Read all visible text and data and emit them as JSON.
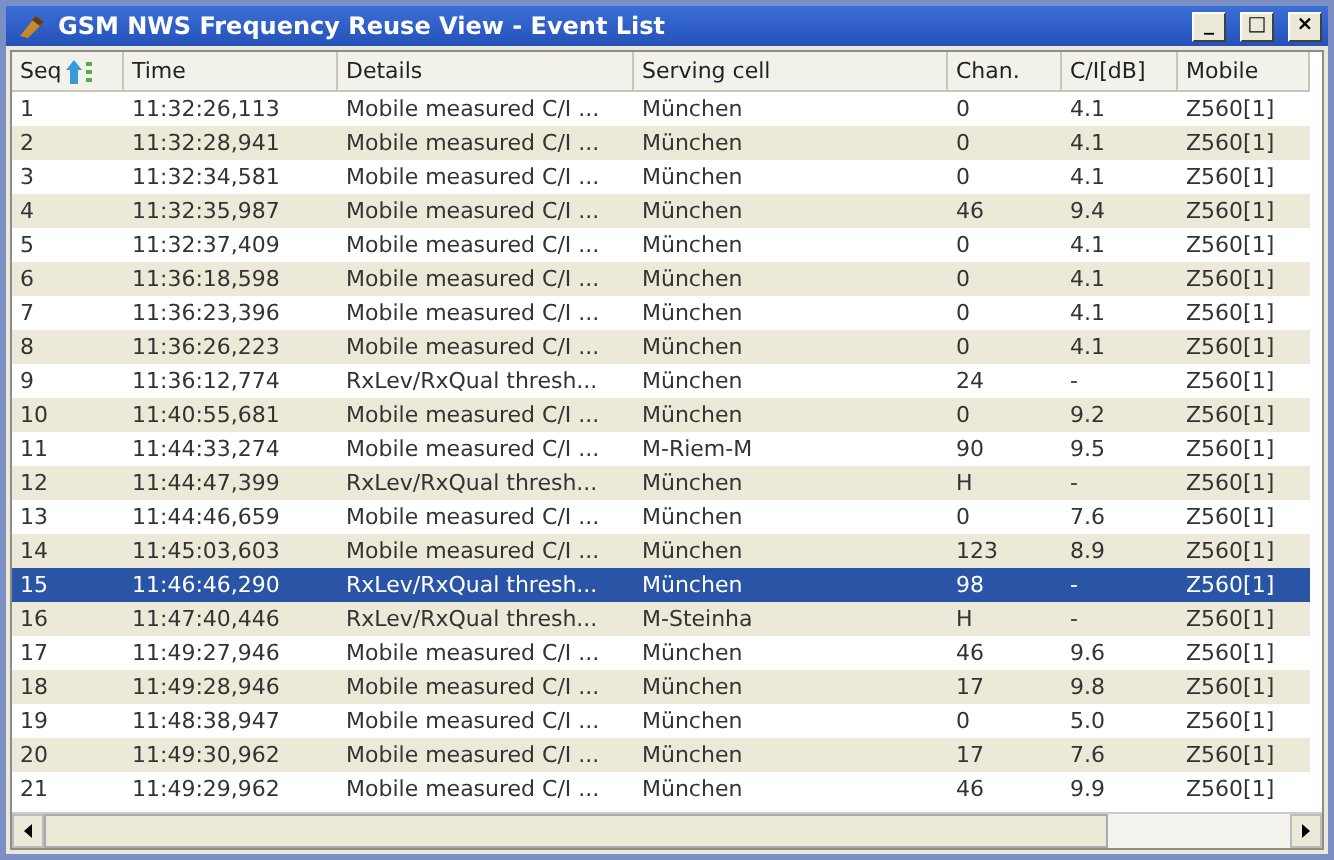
{
  "window": {
    "title": "GSM NWS Frequency Reuse View - Event List",
    "controls": [
      "_",
      "□",
      "×"
    ]
  },
  "table": {
    "columns": [
      {
        "label": "Seq",
        "sorted": true
      },
      {
        "label": "Time",
        "sorted": false
      },
      {
        "label": "Details",
        "sorted": false
      },
      {
        "label": "Serving cell",
        "sorted": false
      },
      {
        "label": "Chan.",
        "sorted": false
      },
      {
        "label": "C/I[dB]",
        "sorted": false
      },
      {
        "label": "Mobile",
        "sorted": false
      }
    ],
    "rows": [
      {
        "cells": [
          "1",
          "11:32:26,113",
          "Mobile measured C/I ...",
          "München",
          "0",
          "4.1",
          "Z560[1]"
        ],
        "selected": false
      },
      {
        "cells": [
          "2",
          "11:32:28,941",
          "Mobile measured C/I ...",
          "München",
          "0",
          "4.1",
          "Z560[1]"
        ],
        "selected": false
      },
      {
        "cells": [
          "3",
          "11:32:34,581",
          "Mobile measured C/I ...",
          "München",
          "0",
          "4.1",
          "Z560[1]"
        ],
        "selected": false
      },
      {
        "cells": [
          "4",
          "11:32:35,987",
          "Mobile measured C/I ...",
          "München",
          "46",
          "9.4",
          "Z560[1]"
        ],
        "selected": false
      },
      {
        "cells": [
          "5",
          "11:32:37,409",
          "Mobile measured C/I ...",
          "München",
          "0",
          "4.1",
          "Z560[1]"
        ],
        "selected": false
      },
      {
        "cells": [
          "6",
          "11:36:18,598",
          "Mobile measured C/I ...",
          "München",
          "0",
          "4.1",
          "Z560[1]"
        ],
        "selected": false
      },
      {
        "cells": [
          "7",
          "11:36:23,396",
          "Mobile measured C/I ...",
          "München",
          "0",
          "4.1",
          "Z560[1]"
        ],
        "selected": false
      },
      {
        "cells": [
          "8",
          "11:36:26,223",
          "Mobile measured C/I ...",
          "München",
          "0",
          "4.1",
          "Z560[1]"
        ],
        "selected": false
      },
      {
        "cells": [
          "9",
          "11:36:12,774",
          "RxLev/RxQual thresh...",
          "München",
          "24",
          "-",
          "Z560[1]"
        ],
        "selected": false
      },
      {
        "cells": [
          "10",
          "11:40:55,681",
          "Mobile measured C/I ...",
          "München",
          "0",
          "9.2",
          "Z560[1]"
        ],
        "selected": false
      },
      {
        "cells": [
          "11",
          "11:44:33,274",
          "Mobile measured C/I ...",
          "M-Riem-M",
          "90",
          "9.5",
          "Z560[1]"
        ],
        "selected": false
      },
      {
        "cells": [
          "12",
          "11:44:47,399",
          "RxLev/RxQual thresh...",
          "München",
          "H",
          "-",
          "Z560[1]"
        ],
        "selected": false
      },
      {
        "cells": [
          "13",
          "11:44:46,659",
          "Mobile measured C/I ...",
          "München",
          "0",
          "7.6",
          "Z560[1]"
        ],
        "selected": false
      },
      {
        "cells": [
          "14",
          "11:45:03,603",
          "Mobile measured C/I ...",
          "München",
          "123",
          "8.9",
          "Z560[1]"
        ],
        "selected": false
      },
      {
        "cells": [
          "15",
          "11:46:46,290",
          "RxLev/RxQual thresh...",
          "München",
          "98",
          "-",
          "Z560[1]"
        ],
        "selected": true
      },
      {
        "cells": [
          "16",
          "11:47:40,446",
          "RxLev/RxQual thresh...",
          "M-Steinha",
          "H",
          "-",
          "Z560[1]"
        ],
        "selected": false
      },
      {
        "cells": [
          "17",
          "11:49:27,946",
          "Mobile measured C/I ...",
          "München",
          "46",
          "9.6",
          "Z560[1]"
        ],
        "selected": false
      },
      {
        "cells": [
          "18",
          "11:49:28,946",
          "Mobile measured C/I ...",
          "München",
          "17",
          "9.8",
          "Z560[1]"
        ],
        "selected": false
      },
      {
        "cells": [
          "19",
          "11:48:38,947",
          "Mobile measured C/I ...",
          "München",
          "0",
          "5.0",
          "Z560[1]"
        ],
        "selected": false
      },
      {
        "cells": [
          "20",
          "11:49:30,962",
          "Mobile measured C/I ...",
          "München",
          "17",
          "7.6",
          "Z560[1]"
        ],
        "selected": false
      },
      {
        "cells": [
          "21",
          "11:49:29,962",
          "Mobile measured C/I ...",
          "München",
          "46",
          "9.9",
          "Z560[1]"
        ],
        "selected": false
      }
    ]
  }
}
